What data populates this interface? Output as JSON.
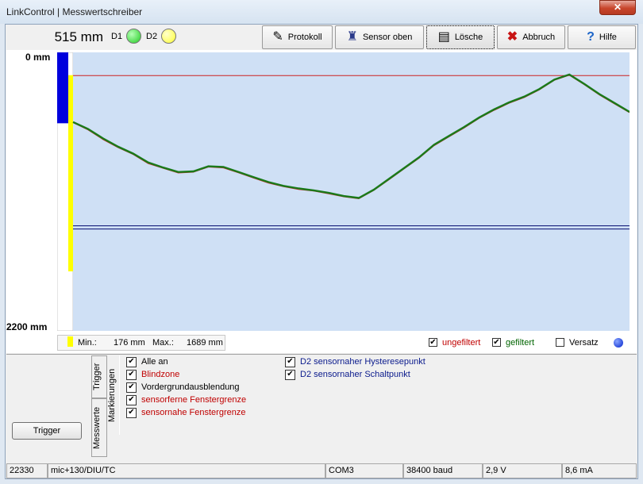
{
  "window": {
    "title": "LinkControl | Messwertschreiber",
    "close_glyph": "✕"
  },
  "toolbar": {
    "reading": "515 mm",
    "d1_label": "D1",
    "d2_label": "D2",
    "d1_color": "#22cc22",
    "d2_color": "#ffff33",
    "buttons": [
      {
        "label": "Protokoll",
        "icon": "pencil-icon"
      },
      {
        "label": "Sensor oben",
        "icon": "sensor-icon"
      },
      {
        "label": "Lösche",
        "icon": "erase-icon"
      },
      {
        "label": "Abbruch",
        "icon": "cross-icon"
      },
      {
        "label": "Hilfe",
        "icon": "help-icon"
      }
    ]
  },
  "chart": {
    "y_top_label": "0 mm",
    "y_bottom_label": "2200 mm",
    "colors": {
      "background": "#cfe0f5",
      "filtered": "#1a7a1a",
      "unfiltered": "#cc2222",
      "upper_line": "#cc2222",
      "lower_line": "#1a237e",
      "blind_zone": "#0000dd",
      "window_band": "#ffff00"
    }
  },
  "chart_data": {
    "type": "line",
    "y_range": [
      0,
      2200
    ],
    "y_axis_inverted": true,
    "series": [
      {
        "name": "gefiltert",
        "values": [
          550,
          605,
          680,
          745,
          800,
          870,
          910,
          945,
          940,
          900,
          905,
          945,
          985,
          1025,
          1055,
          1075,
          1090,
          1110,
          1135,
          1150,
          1085,
          1000,
          915,
          830,
          730,
          660,
          590,
          515,
          450,
          395,
          350,
          290,
          215,
          175,
          250,
          330,
          400,
          470
        ]
      },
      {
        "name": "ungefiltert",
        "values": [
          555,
          612,
          688,
          752,
          806,
          878,
          916,
          952,
          946,
          905,
          912,
          951,
          992,
          1032,
          1060,
          1082,
          1095,
          1116,
          1140,
          1156,
          1090,
          1006,
          921,
          836,
          737,
          667,
          597,
          521,
          457,
          401,
          356,
          296,
          220,
          180,
          256,
          336,
          407,
          476
        ]
      }
    ],
    "reference_lines": {
      "upper": 183,
      "lower_a": 1370,
      "lower_b": 1395
    },
    "blind_zone": [
      0,
      560
    ],
    "window_band": [
      180,
      1730
    ]
  },
  "stats": {
    "min_label": "Min.:",
    "min_value": "176 mm",
    "max_label": "Max.:",
    "max_value": "1689 mm"
  },
  "legend": {
    "ungefiltert": "ungefiltert",
    "gefiltert": "gefiltert",
    "versatz": "Versatz",
    "ungefiltert_checked": true,
    "gefiltert_checked": true,
    "versatz_checked": false
  },
  "lower": {
    "trigger_button": "Trigger",
    "tabs": [
      "Trigger",
      "Messwerte",
      "Markierungen"
    ],
    "options_left": [
      {
        "label": "Alle an",
        "checked": true,
        "color": "black"
      },
      {
        "label": "Blindzone",
        "checked": true,
        "color": "red"
      },
      {
        "label": "Vordergrundausblendung",
        "checked": true,
        "color": "black"
      },
      {
        "label": "sensorferne Fenstergrenze",
        "checked": true,
        "color": "red"
      },
      {
        "label": "sensornahe Fenstergrenze",
        "checked": true,
        "color": "red"
      }
    ],
    "options_right": [
      {
        "label": "D2 sensornaher Hysteresepunkt",
        "checked": true,
        "color": "blue"
      },
      {
        "label": "D2 sensornaher Schaltpunkt",
        "checked": true,
        "color": "blue"
      }
    ]
  },
  "statusbar": {
    "count": "22330",
    "device": "mic+130/DIU/TC",
    "port": "COM3",
    "baud": "38400 baud",
    "voltage": "2,9 V",
    "current": "8,6 mA"
  }
}
